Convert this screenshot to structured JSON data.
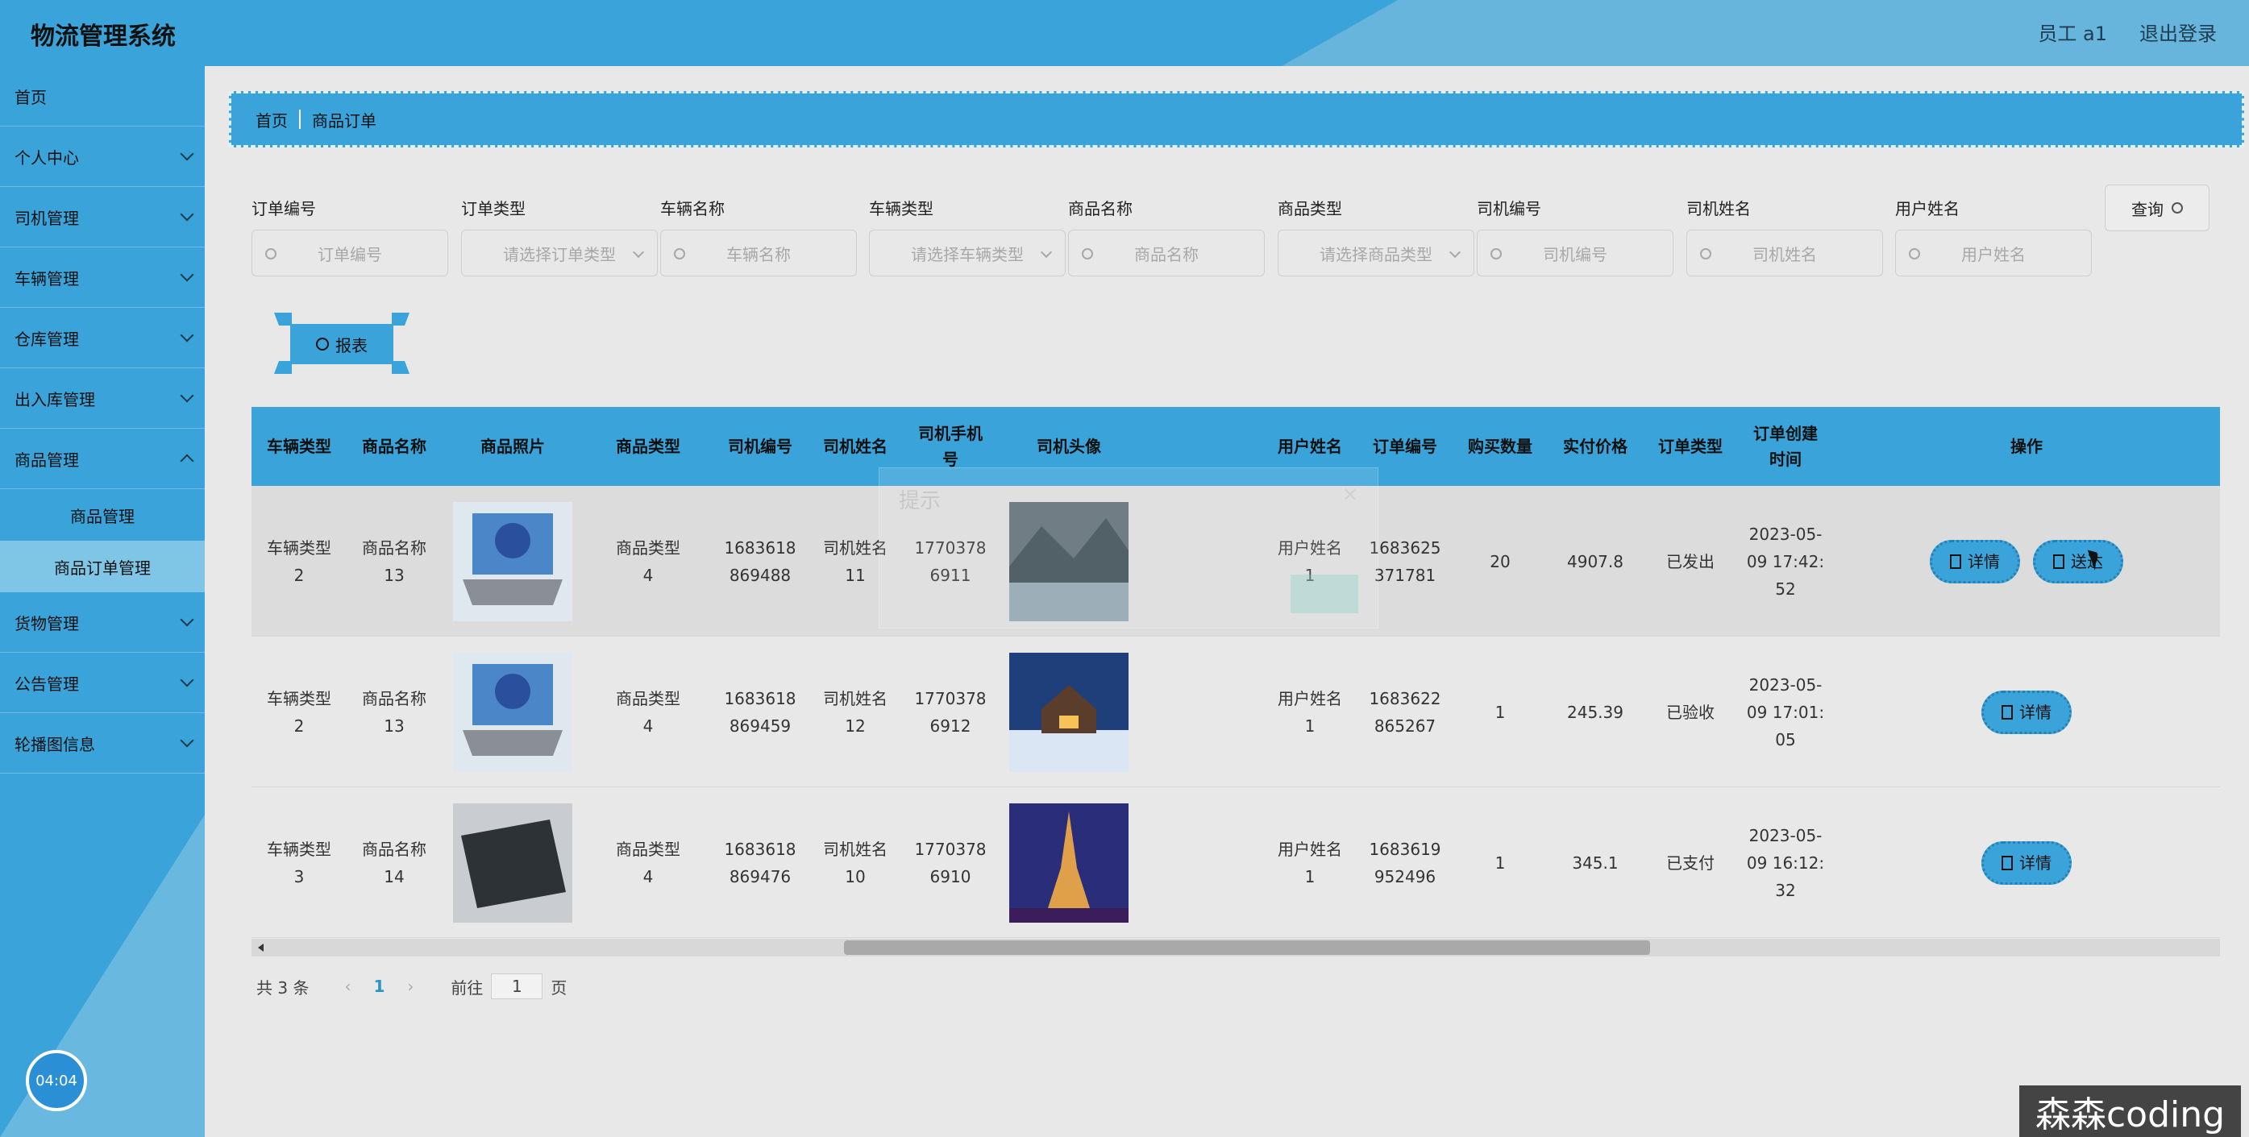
{
  "header": {
    "app_title": "物流管理系统",
    "user_info": "员工 a1",
    "logout": "退出登录"
  },
  "sidebar": {
    "items": [
      {
        "label": "首页"
      },
      {
        "label": "个人中心"
      },
      {
        "label": "司机管理"
      },
      {
        "label": "车辆管理"
      },
      {
        "label": "仓库管理"
      },
      {
        "label": "出入库管理"
      },
      {
        "label": "商品管理"
      },
      {
        "label": "货物管理"
      },
      {
        "label": "公告管理"
      },
      {
        "label": "轮播图信息"
      }
    ],
    "sub_items": [
      {
        "label": "商品管理"
      },
      {
        "label": "商品订单管理"
      }
    ],
    "timer": "04:04"
  },
  "breadcrumb": {
    "home": "首页",
    "current": "商品订单"
  },
  "search": {
    "fields": [
      {
        "label": "订单编号",
        "placeholder": "订单编号"
      },
      {
        "label": "订单类型",
        "placeholder": "请选择订单类型"
      },
      {
        "label": "车辆名称",
        "placeholder": "车辆名称"
      },
      {
        "label": "车辆类型",
        "placeholder": "请选择车辆类型"
      },
      {
        "label": "商品名称",
        "placeholder": "商品名称"
      },
      {
        "label": "商品类型",
        "placeholder": "请选择商品类型"
      },
      {
        "label": "司机编号",
        "placeholder": "司机编号"
      },
      {
        "label": "司机姓名",
        "placeholder": "司机姓名"
      },
      {
        "label": "用户姓名",
        "placeholder": "用户姓名"
      }
    ],
    "query_label": "查询",
    "report_label": "报表"
  },
  "table": {
    "headers": [
      "车辆类型",
      "商品名称",
      "商品照片",
      "商品类型",
      "司机编号",
      "司机姓名",
      "司机手机号",
      "司机头像",
      "用户姓名",
      "订单编号",
      "购买数量",
      "实付价格",
      "订单类型",
      "订单创建时间",
      "操作"
    ],
    "rows": [
      {
        "vehicle_type": "车辆类型2",
        "product_name": "商品名称13",
        "product_type": "商品类型4",
        "driver_no": "1683618869488",
        "driver_name": "司机姓名11",
        "driver_phone": "17703786911",
        "user_name": "用户姓名1",
        "order_no": "1683625371781",
        "qty": "20",
        "price": "4907.8",
        "order_type": "已发出",
        "created": "2023-05-09 17:42:52",
        "actions": [
          "详情",
          "送达"
        ]
      },
      {
        "vehicle_type": "车辆类型2",
        "product_name": "商品名称13",
        "product_type": "商品类型4",
        "driver_no": "1683618869459",
        "driver_name": "司机姓名12",
        "driver_phone": "17703786912",
        "user_name": "用户姓名1",
        "order_no": "1683622865267",
        "qty": "1",
        "price": "245.39",
        "order_type": "已验收",
        "created": "2023-05-09 17:01:05",
        "actions": [
          "详情"
        ]
      },
      {
        "vehicle_type": "车辆类型3",
        "product_name": "商品名称14",
        "product_type": "商品类型4",
        "driver_no": "1683618869476",
        "driver_name": "司机姓名10",
        "driver_phone": "17703786910",
        "user_name": "用户姓名1",
        "order_no": "1683619952496",
        "qty": "1",
        "price": "345.1",
        "order_type": "已支付",
        "created": "2023-05-09 16:12:32",
        "actions": [
          "详情"
        ]
      }
    ]
  },
  "pagination": {
    "total": "共 3 条",
    "current_page": "1",
    "goto_prefix": "前往",
    "goto_value": "1",
    "goto_suffix": "页"
  },
  "dialog": {
    "title": "提示",
    "close": "×"
  },
  "watermark": "森森coding",
  "colors": {
    "primary": "#3aa3d9",
    "background": "#e8e8e8",
    "accent_page": "#2a93c9"
  }
}
